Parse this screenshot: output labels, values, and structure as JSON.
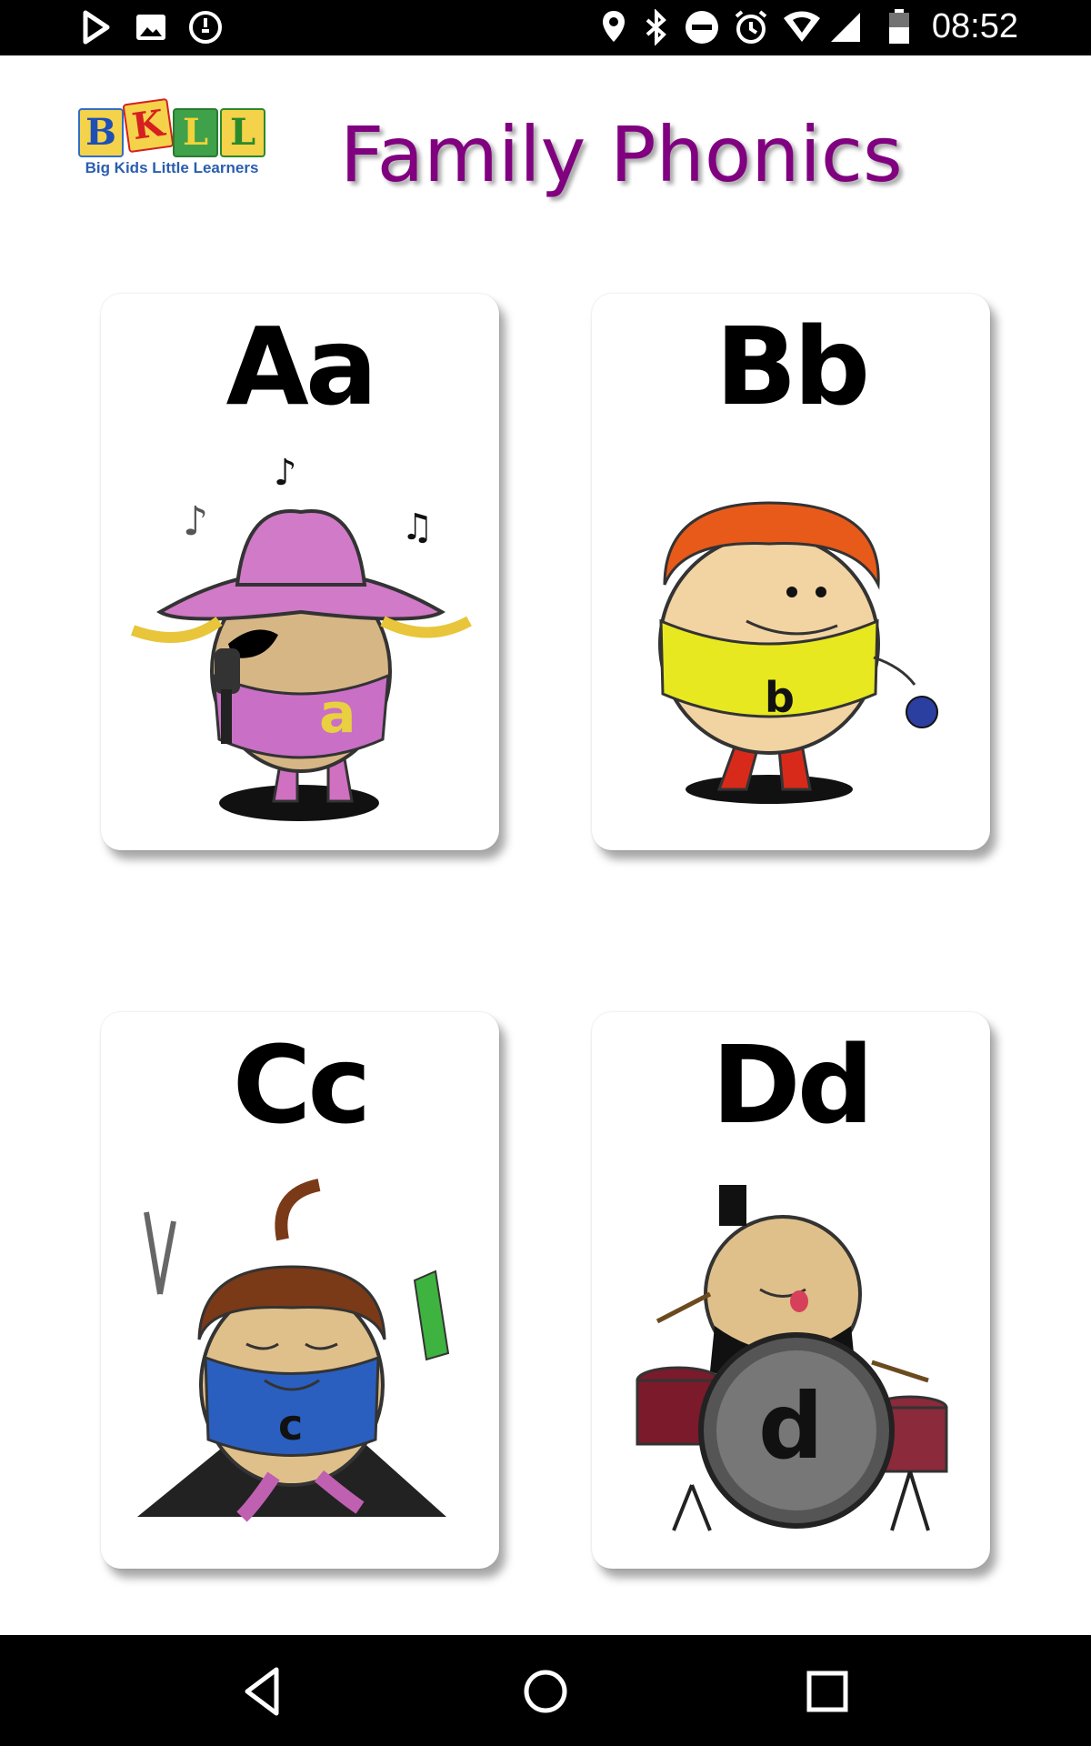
{
  "status_bar": {
    "time": "08:52",
    "left_icons": [
      "play-store-icon",
      "image-icon",
      "timer-icon"
    ],
    "right_icons": [
      "location-icon",
      "bluetooth-icon",
      "do-not-disturb-icon",
      "alarm-icon",
      "wifi-icon",
      "signal-icon",
      "battery-icon"
    ]
  },
  "header": {
    "logo_letters": [
      "B",
      "K",
      "L",
      "L"
    ],
    "logo_tagline": "Big Kids Little Learners",
    "title": "Family Phonics"
  },
  "cards": [
    {
      "letter": "Aa",
      "character_letter": "a"
    },
    {
      "letter": "Bb",
      "character_letter": "b"
    },
    {
      "letter": "Cc",
      "character_letter": "c"
    },
    {
      "letter": "Dd",
      "character_letter": "d"
    }
  ],
  "nav_bar": {
    "buttons": [
      "back-icon",
      "home-icon",
      "recents-icon"
    ]
  },
  "colors": {
    "title": "#800080",
    "status_bar": "#000000",
    "nav_bar": "#000000"
  }
}
